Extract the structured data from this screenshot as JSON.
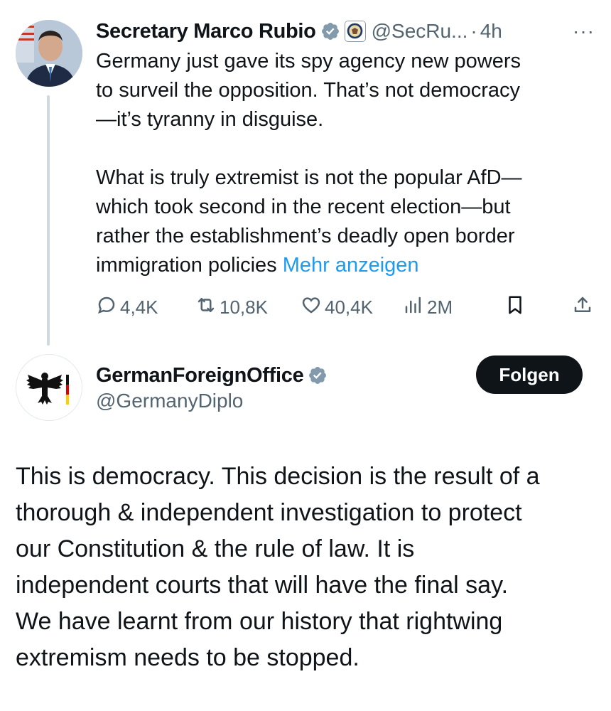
{
  "tweet1": {
    "author_name": "Secretary Marco Rubio",
    "handle": "@SecRu...",
    "dot": "·",
    "time": "4h",
    "more": "···",
    "text_lines_p1": [
      "Germany just gave its spy agency new powers",
      "to surveil the opposition.  That’s not democracy",
      "—it’s tyranny in disguise."
    ],
    "text_lines_p2": [
      "What is truly extremist is not the popular AfD—",
      "which took second in the recent election—but",
      "rather the establishment’s deadly open border"
    ],
    "last_line": "immigration policies ",
    "show_more": "Mehr anzeigen",
    "stats": {
      "replies": "4,4K",
      "reposts": "10,8K",
      "likes": "40,4K",
      "views": "2M"
    }
  },
  "tweet2": {
    "author_name": "GermanForeignOffice",
    "handle": "@GermanyDiplo",
    "follow_label": "Folgen",
    "text_lines": [
      "This is democracy. This decision is the result of a",
      "thorough & independent investigation to protect",
      "our Constitution & the rule of law. It is",
      "independent courts that will have the final say.",
      "We have learnt from our history that rightwing",
      "extremism needs to be stopped."
    ]
  },
  "colors": {
    "text": "#0f1419",
    "secondary": "#536471",
    "link": "#1d9bf0",
    "verified_gray": "#829aab",
    "button": "#0f1419"
  },
  "icons": [
    "verified-badge-icon",
    "state-department-seal-icon",
    "more-icon",
    "reply-icon",
    "repost-icon",
    "like-icon",
    "views-icon",
    "bookmark-icon",
    "share-icon",
    "federal-eagle-icon"
  ]
}
